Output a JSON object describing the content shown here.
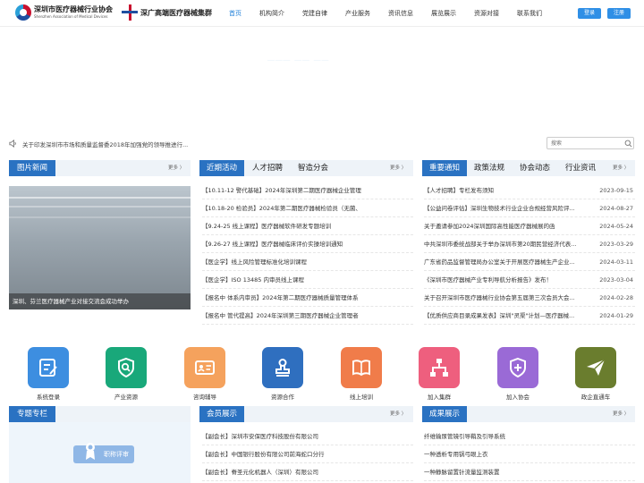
{
  "header": {
    "logo1_cn": "深圳市医疗器械行业协会",
    "logo1_en": "Shenzhen Association of Medical Devices",
    "logo2": "深广高端医疗器械集群",
    "nav": [
      "首页",
      "机构简介",
      "党建自律",
      "产业服务",
      "资讯信息",
      "展览展示",
      "资源对接",
      "联系我们"
    ],
    "login": "登录",
    "register": "注册"
  },
  "notice": {
    "text": "关于印发深圳市市场和质量监督委2018年加强党的领导推进行..."
  },
  "search": {
    "placeholder": "搜索"
  },
  "photo_news": {
    "title": "图片新闻",
    "more": "更多 〉",
    "caption": "深圳、芬兰医疗器械产业对接交流会成功举办"
  },
  "activities": {
    "tabs": [
      "近期活动",
      "人才招聘",
      "智造分会"
    ],
    "more": "更多 〉",
    "items": [
      "【10.11-12 警代基础】2024年深圳第二期医疗器械企业管理",
      "【10.18-20 检验员】2024年第二期医疗器械检验员（无菌、",
      "【9.24-25 线上课程】医疗器械软件研发专题培训",
      "【9.26-27 线上课程】医疗器械临床评价实操培训通知",
      "【医企学】线上风险管理标准化培训课程",
      "【医企学】ISO 13485 内审员线上课程",
      "【报名中 体系内审员】2024年第二期医疗器械质量管理体系",
      "【报名中 管代提高】2024年深圳第三期医疗器械企业管理者"
    ]
  },
  "notices": {
    "tabs": [
      "重要通知",
      "政策法规",
      "协会动态",
      "行业资讯"
    ],
    "more": "更多 〉",
    "items": [
      {
        "title": "【人才招聘】专栏发布须知",
        "date": "2023-09-15"
      },
      {
        "title": "【公益问卷评估】深圳生物技术行业企业合规经营风险评...",
        "date": "2024-08-27"
      },
      {
        "title": "关于邀请参加2024深圳国际高性能医疗器械展的函",
        "date": "2024-05-24"
      },
      {
        "title": "中共深圳市委统战部关于举办深圳市第20期民营经济代表...",
        "date": "2023-03-29"
      },
      {
        "title": "广东省药品监督管理局办公室关于开展医疗器械生产企业...",
        "date": "2024-03-11"
      },
      {
        "title": "《深圳市医疗器械产业专利导航分析报告》发布！",
        "date": "2023-03-04"
      },
      {
        "title": "关于召开深圳市医疗器械行业协会第五届第三次会员大会...",
        "date": "2024-02-28"
      },
      {
        "title": "【优质供应商目录成果发表】深圳\"灵渠\"计划—医疗器械...",
        "date": "2024-01-29"
      }
    ]
  },
  "services": [
    {
      "label": "系统登录",
      "icon": "edit-icon",
      "color": "#3d8ee0"
    },
    {
      "label": "产业资源",
      "icon": "search-icon",
      "color": "#19a87a"
    },
    {
      "label": "咨询辅导",
      "icon": "id-card-icon",
      "color": "#f5a25d"
    },
    {
      "label": "资源合作",
      "icon": "stamp-icon",
      "color": "#2f6fbf"
    },
    {
      "label": "线上培训",
      "icon": "book-icon",
      "color": "#f07c4a"
    },
    {
      "label": "加入集群",
      "icon": "network-icon",
      "color": "#ee5f7e"
    },
    {
      "label": "加入协会",
      "icon": "plus-shield-icon",
      "color": "#9a6ad6"
    },
    {
      "label": "政企直通车",
      "icon": "paper-plane-icon",
      "color": "#6a7d2e"
    }
  ],
  "columns": {
    "title": "专题专栏",
    "expert_button": "职称评审"
  },
  "members": {
    "title": "会员展示",
    "more": "更多 〉",
    "items": [
      "【副会长】深圳市安保医疗科技股份有限公司",
      "【副会长】中国银行股份有限公司前海蛇口分行",
      "【副会长】脊圣元化机器人（深圳）有限公司"
    ]
  },
  "achievements": {
    "title": "成果展示",
    "more": "更多 〉",
    "items": [
      "纤维输尿管镜引导鞘及引导系统",
      "一种透析专用锅弓眼上衣",
      "一种静脉留置针流量监测装置"
    ]
  }
}
